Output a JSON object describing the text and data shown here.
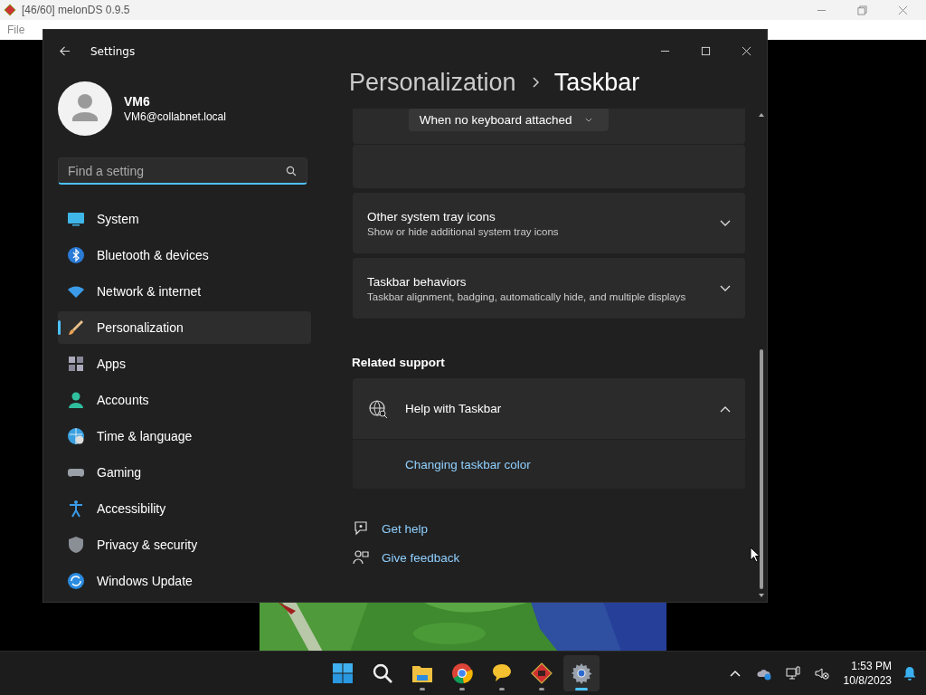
{
  "emulator_window": {
    "title": "[46/60] melonDS 0.9.5",
    "menu": [
      "File"
    ]
  },
  "settings": {
    "title": "Settings",
    "account": {
      "name": "VM6",
      "email": "VM6@collabnet.local"
    },
    "search": {
      "placeholder": "Find a setting"
    },
    "nav": [
      {
        "kind": "system",
        "label": "System",
        "selected": false
      },
      {
        "kind": "bluetooth",
        "label": "Bluetooth & devices",
        "selected": false
      },
      {
        "kind": "network",
        "label": "Network & internet",
        "selected": false
      },
      {
        "kind": "personalization",
        "label": "Personalization",
        "selected": true
      },
      {
        "kind": "apps",
        "label": "Apps",
        "selected": false
      },
      {
        "kind": "accounts",
        "label": "Accounts",
        "selected": false
      },
      {
        "kind": "time",
        "label": "Time & language",
        "selected": false
      },
      {
        "kind": "gaming",
        "label": "Gaming",
        "selected": false
      },
      {
        "kind": "accessibility",
        "label": "Accessibility",
        "selected": false
      },
      {
        "kind": "privacy",
        "label": "Privacy & security",
        "selected": false
      },
      {
        "kind": "update",
        "label": "Windows Update",
        "selected": false
      }
    ],
    "breadcrumb": [
      "Personalization",
      "Taskbar"
    ],
    "dropdown": {
      "value": "When no keyboard attached"
    },
    "sections": [
      {
        "title": "Other system tray icons",
        "description": "Show or hide additional system tray icons",
        "expanded": false
      },
      {
        "title": "Taskbar behaviors",
        "description": "Taskbar alignment, badging, automatically hide, and multiple displays",
        "expanded": false
      }
    ],
    "related_support": {
      "heading": "Related support",
      "title": "Help with Taskbar",
      "expanded": true,
      "links": [
        "Changing taskbar color"
      ]
    },
    "footer_links": [
      {
        "kind": "help",
        "label": "Get help"
      },
      {
        "kind": "feedback",
        "label": "Give feedback"
      }
    ]
  },
  "taskbar": {
    "apps": [
      {
        "kind": "start",
        "running": false,
        "selected": false
      },
      {
        "kind": "search",
        "running": false,
        "selected": false
      },
      {
        "kind": "explorer",
        "running": true,
        "selected": false
      },
      {
        "kind": "browser",
        "running": true,
        "selected": false
      },
      {
        "kind": "chat",
        "running": true,
        "selected": false
      },
      {
        "kind": "emulator",
        "running": true,
        "selected": false
      },
      {
        "kind": "settings",
        "running": true,
        "selected": true
      }
    ],
    "time": "1:53 PM",
    "date": "10/8/2023"
  }
}
